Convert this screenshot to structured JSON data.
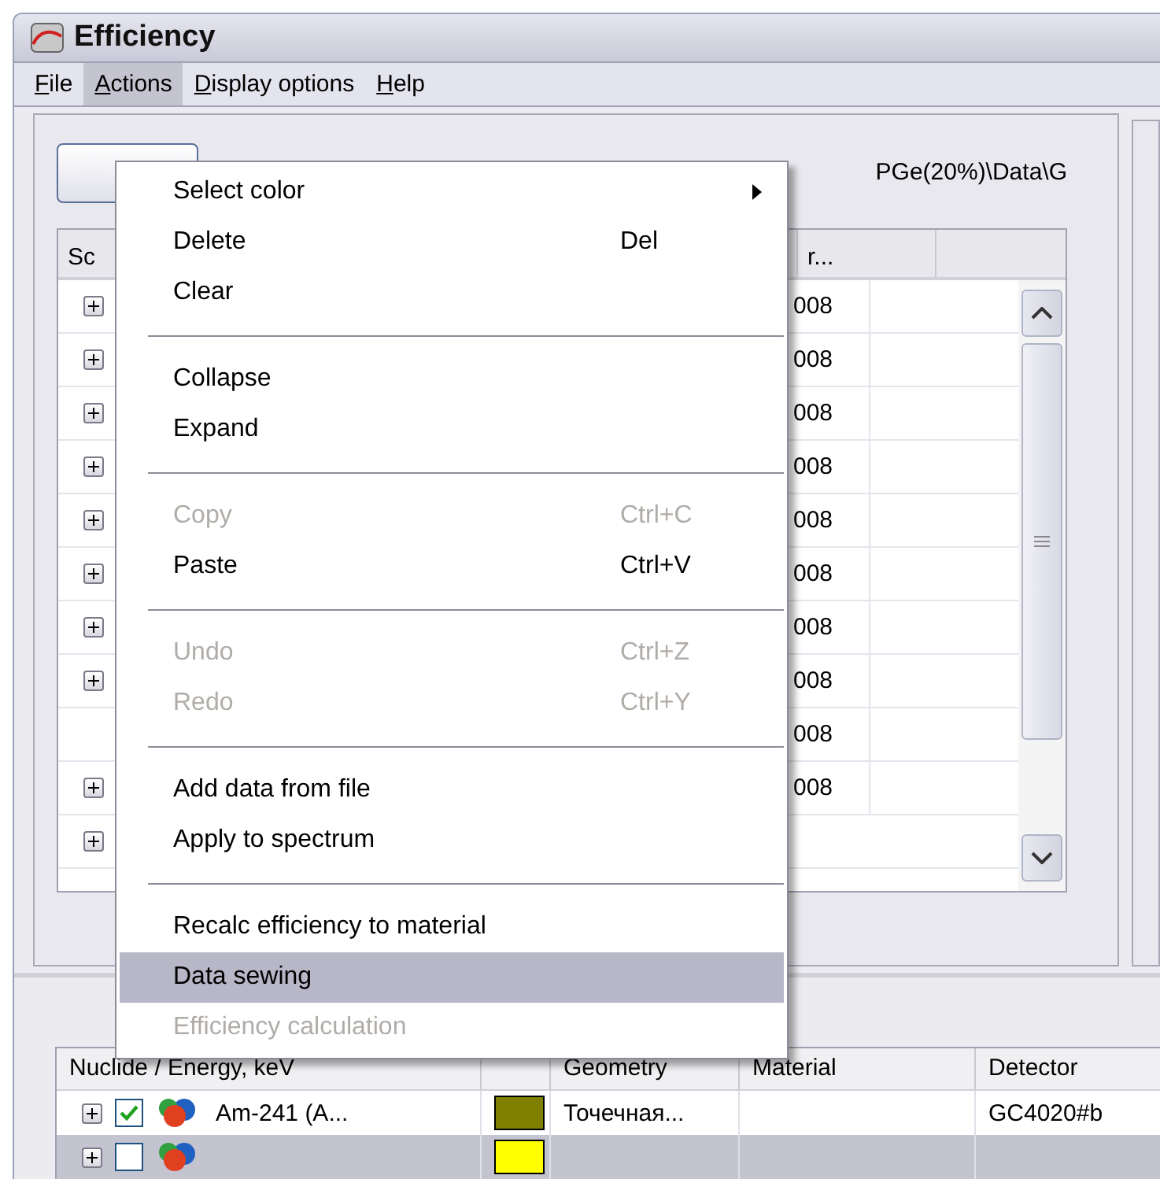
{
  "window": {
    "title": "Efficiency"
  },
  "menu_bar": [
    {
      "mnemonic": "F",
      "rest": "ile",
      "selected": false
    },
    {
      "mnemonic": "A",
      "rest": "ctions",
      "selected": true
    },
    {
      "mnemonic": "D",
      "rest": "isplay options",
      "selected": false
    },
    {
      "mnemonic": "H",
      "rest": "elp",
      "selected": false
    }
  ],
  "actions_menu": [
    {
      "kind": "item",
      "label": "Select color",
      "submenu": true,
      "disabled": false,
      "highlighted": false
    },
    {
      "kind": "item",
      "label": "Delete",
      "shortcut": "Del",
      "disabled": false,
      "highlighted": false
    },
    {
      "kind": "item",
      "label": "Clear",
      "disabled": false,
      "highlighted": false
    },
    {
      "kind": "separator"
    },
    {
      "kind": "item",
      "label": "Collapse",
      "disabled": false,
      "highlighted": false
    },
    {
      "kind": "item",
      "label": "Expand",
      "disabled": false,
      "highlighted": false
    },
    {
      "kind": "separator"
    },
    {
      "kind": "item",
      "label": "Copy",
      "shortcut": "Ctrl+C",
      "disabled": true,
      "highlighted": false
    },
    {
      "kind": "item",
      "label": "Paste",
      "shortcut": "Ctrl+V",
      "disabled": false,
      "highlighted": false
    },
    {
      "kind": "separator"
    },
    {
      "kind": "item",
      "label": "Undo",
      "shortcut": "Ctrl+Z",
      "disabled": true,
      "highlighted": false
    },
    {
      "kind": "item",
      "label": "Redo",
      "shortcut": "Ctrl+Y",
      "disabled": true,
      "highlighted": false
    },
    {
      "kind": "separator"
    },
    {
      "kind": "item",
      "label": "Add data from file",
      "disabled": false,
      "highlighted": false
    },
    {
      "kind": "item",
      "label": "Apply to spectrum",
      "disabled": false,
      "highlighted": false
    },
    {
      "kind": "separator"
    },
    {
      "kind": "item",
      "label": "Recalc efficiency to material",
      "disabled": false,
      "highlighted": false
    },
    {
      "kind": "item",
      "label": "Data sewing",
      "disabled": false,
      "highlighted": true
    },
    {
      "kind": "item",
      "label": "Efficiency calculation",
      "disabled": true,
      "highlighted": false
    }
  ],
  "data_panel": {
    "path": "PGe(20%)\\Data\\G",
    "columns": [
      {
        "label": "Sc"
      },
      {
        "label": "r..."
      }
    ],
    "rows": [
      {
        "expandable": true,
        "value": "008"
      },
      {
        "expandable": true,
        "value": "008"
      },
      {
        "expandable": true,
        "value": "008"
      },
      {
        "expandable": true,
        "value": "008"
      },
      {
        "expandable": true,
        "value": "008"
      },
      {
        "expandable": true,
        "value": "008"
      },
      {
        "expandable": true,
        "value": "008"
      },
      {
        "expandable": true,
        "value": "008"
      },
      {
        "expandable": false,
        "value": "008"
      },
      {
        "expandable": true,
        "value": "008"
      },
      {
        "expandable": true
      }
    ]
  },
  "nuclide_table": {
    "columns": [
      {
        "label": "Nuclide / Energy, keV"
      },
      {},
      {
        "label": "Geometry"
      },
      {
        "label": "Material"
      },
      {
        "label": "Detector"
      }
    ],
    "rows": [
      {
        "selected": false,
        "checked": true,
        "nuclide": "Am-241 (A...",
        "color": "#808000",
        "geometry": "Точечная...",
        "detector": "GC4020#b"
      },
      {
        "selected": true,
        "color": "#ffff00"
      }
    ]
  }
}
